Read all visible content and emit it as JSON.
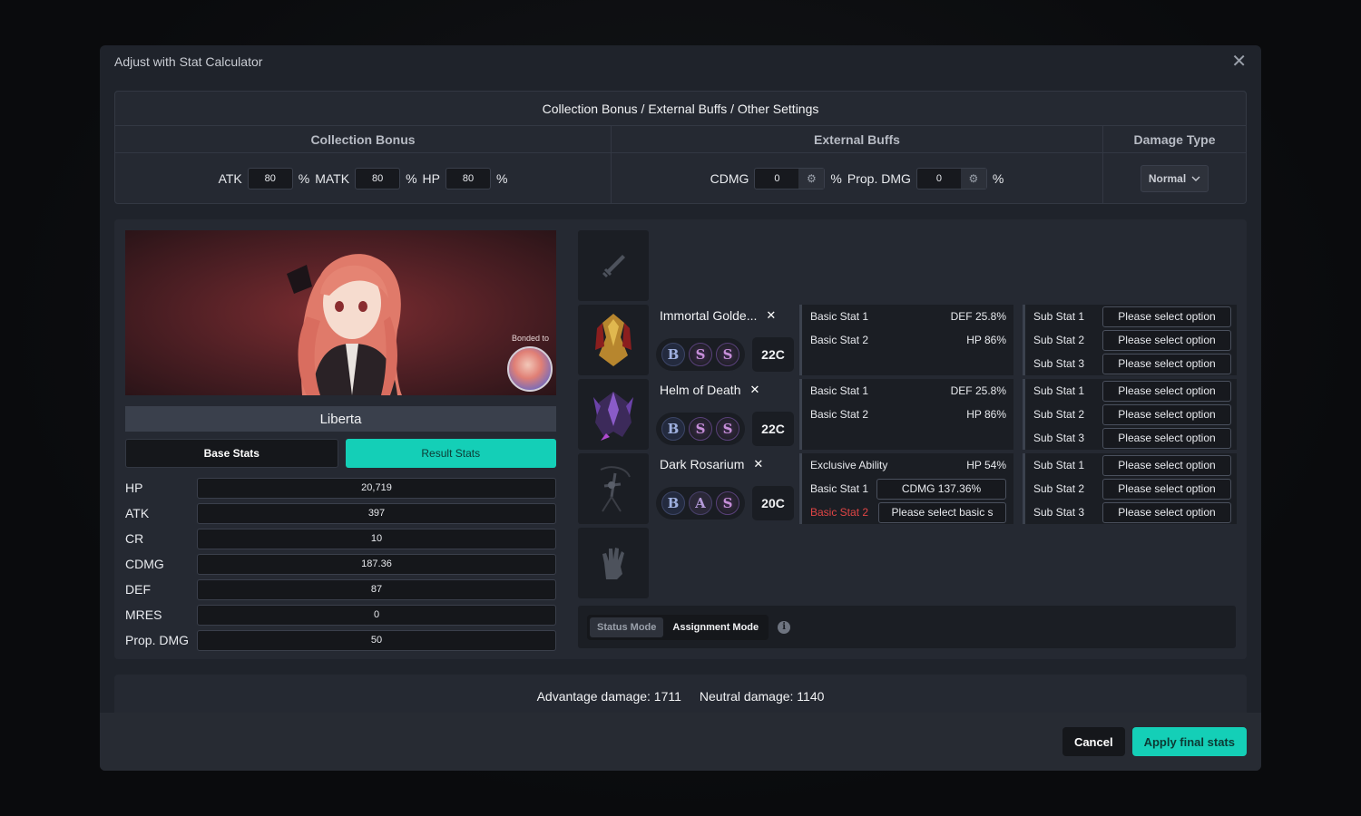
{
  "modal": {
    "title": "Adjust with Stat Calculator",
    "close": "✕"
  },
  "settings": {
    "title": "Collection Bonus / External Buffs / Other Settings",
    "collection": {
      "header": "Collection Bonus",
      "atk_label": "ATK",
      "atk_value": "80",
      "matk_label": "MATK",
      "matk_value": "80",
      "hp_label": "HP",
      "hp_value": "80",
      "pct": "%"
    },
    "external": {
      "header": "External Buffs",
      "cdmg_label": "CDMG",
      "cdmg_value": "0",
      "prop_label": "Prop. DMG",
      "prop_value": "0",
      "pct": "%"
    },
    "damage_type": {
      "header": "Damage Type",
      "selected": "Normal"
    }
  },
  "character": {
    "bonded_label": "Bonded to",
    "name": "Liberta",
    "tab_base": "Base Stats",
    "tab_result": "Result Stats",
    "stats": [
      {
        "label": "HP",
        "value": "20,719"
      },
      {
        "label": "ATK",
        "value": "397"
      },
      {
        "label": "CR",
        "value": "10"
      },
      {
        "label": "CDMG",
        "value": "187.36"
      },
      {
        "label": "DEF",
        "value": "87"
      },
      {
        "label": "MRES",
        "value": "0"
      },
      {
        "label": "Prop. DMG",
        "value": "50"
      }
    ]
  },
  "equipment": [
    {
      "name": "Immortal Golde...",
      "remove": "✕",
      "tiers": [
        "B",
        "S",
        "S"
      ],
      "level": "22C",
      "basic": [
        {
          "key": "Basic Stat 1",
          "value": "DEF 25.8%"
        },
        {
          "key": "Basic Stat 2",
          "value": "HP 86%"
        }
      ],
      "subs": [
        {
          "key": "Sub Stat 1",
          "value": "Please select option"
        },
        {
          "key": "Sub Stat 2",
          "value": "Please select option"
        },
        {
          "key": "Sub Stat 3",
          "value": "Please select option"
        }
      ]
    },
    {
      "name": "Helm of Death",
      "remove": "✕",
      "tiers": [
        "B",
        "S",
        "S"
      ],
      "level": "22C",
      "basic": [
        {
          "key": "Basic Stat 1",
          "value": "DEF 25.8%"
        },
        {
          "key": "Basic Stat 2",
          "value": "HP 86%"
        }
      ],
      "subs": [
        {
          "key": "Sub Stat 1",
          "value": "Please select option"
        },
        {
          "key": "Sub Stat 2",
          "value": "Please select option"
        },
        {
          "key": "Sub Stat 3",
          "value": "Please select option"
        }
      ]
    },
    {
      "name": "Dark Rosarium",
      "remove": "✕",
      "tiers": [
        "B",
        "A",
        "S"
      ],
      "level": "20C",
      "exclusive": {
        "key": "Exclusive Ability",
        "value": "HP 54%"
      },
      "basic1": {
        "key": "Basic Stat 1",
        "value": "CDMG 137.36%"
      },
      "basic2": {
        "key": "Basic Stat 2",
        "value": "Please select basic s"
      },
      "subs": [
        {
          "key": "Sub Stat 1",
          "value": "Please select option"
        },
        {
          "key": "Sub Stat 2",
          "value": "Please select option"
        },
        {
          "key": "Sub Stat 3",
          "value": "Please select option"
        }
      ]
    }
  ],
  "modes": {
    "status": "Status Mode",
    "assignment": "Assignment Mode",
    "info": "i"
  },
  "damage": {
    "advantage": "Advantage damage: 1711",
    "neutral": "Neutral damage: 1140"
  },
  "footer": {
    "cancel": "Cancel",
    "apply": "Apply final stats"
  },
  "colors": {
    "accent": "#14cfb7",
    "error": "#e04545",
    "panel": "#252932"
  }
}
